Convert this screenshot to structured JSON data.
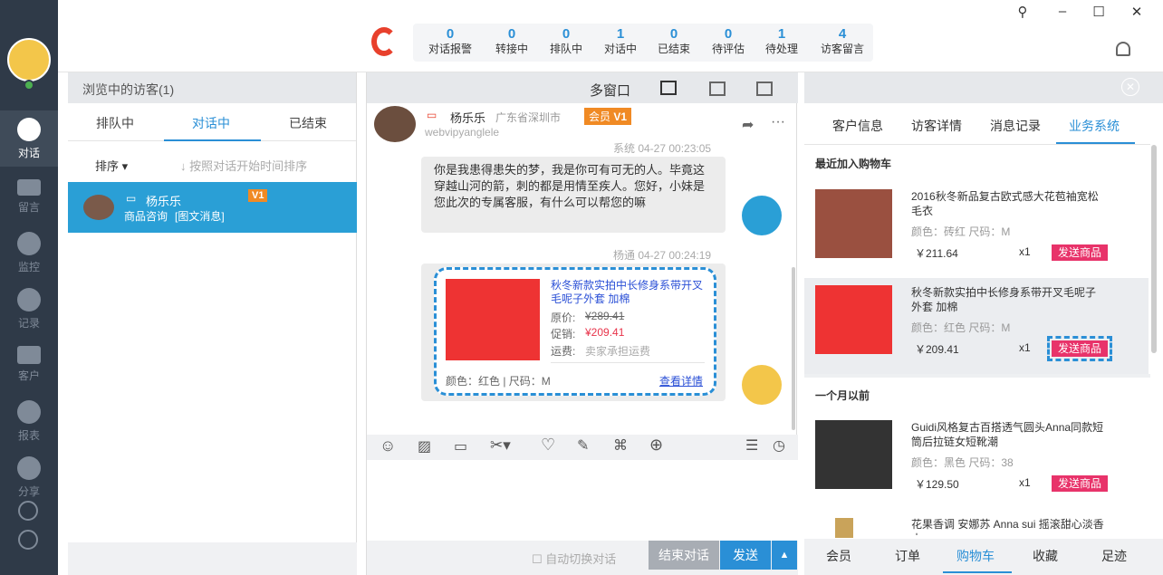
{
  "sidebar": {
    "items": [
      {
        "label": "对话"
      },
      {
        "label": "留言"
      },
      {
        "label": "监控"
      },
      {
        "label": "记录"
      },
      {
        "label": "客户"
      },
      {
        "label": "报表"
      },
      {
        "label": "分享"
      }
    ]
  },
  "stats": [
    {
      "count": "0",
      "label": "对话报警"
    },
    {
      "count": "0",
      "label": "转接中"
    },
    {
      "count": "0",
      "label": "排队中"
    },
    {
      "count": "1",
      "label": "对话中"
    },
    {
      "count": "0",
      "label": "已结束"
    },
    {
      "count": "0",
      "label": "待评估"
    },
    {
      "count": "1",
      "label": "待处理"
    },
    {
      "count": "4",
      "label": "访客留言"
    }
  ],
  "left": {
    "header": "浏览中的访客(1)",
    "tabs": [
      "排队中",
      "对话中",
      "已结束"
    ],
    "sort_label": "排序",
    "sort_hint": "按照对话开始时间排序",
    "visitor": {
      "name": "杨乐乐",
      "badge": "V1",
      "desc": "商品咨询",
      "desc_tag": "[图文消息]"
    }
  },
  "chat": {
    "multi_window": "多窗口",
    "name": "杨乐乐",
    "location": "广东省深圳市",
    "member": "会员",
    "member_level": "V1",
    "visitor_id": "webvipyanglele",
    "msg1_meta": "系统 04-27 00:23:05",
    "msg1_text": "你是我患得患失的梦，我是你可有可无的人。毕竟这穿越山河的箭，刺的都是用情至疾人。您好，小妹是您此次的专属客服，有什么可以帮您的嘛",
    "msg2_meta": "杨通 04-27 00:24:19",
    "card": {
      "title": "秋冬新款实拍中长修身系带开叉毛呢子外套 加棉",
      "orig_label": "原价:",
      "orig": "¥289.41",
      "promo_label": "促销:",
      "promo": "¥209.41",
      "ship_label": "运费:",
      "ship": "卖家承担运费",
      "attr": "颜色：红色 | 尺码：M",
      "detail": "查看详情"
    },
    "auto_switch": "自动切换对话",
    "end_btn": "结束对话",
    "send_btn": "发送"
  },
  "right": {
    "tabs": [
      "客户信息",
      "访客详情",
      "消息记录",
      "业务系统"
    ],
    "recent": "最近加入购物车",
    "older": "一个月以前",
    "products": [
      {
        "name": "2016秋冬新品复古欧式感大花苞袖宽松毛衣",
        "attr": "颜色：砖红 尺码：M",
        "price": "￥211.64",
        "qty": "x1",
        "send": "发送商品"
      },
      {
        "name": "秋冬新款实拍中长修身系带开叉毛呢子外套 加棉",
        "attr": "颜色：红色 尺码：M",
        "price": "￥209.41",
        "qty": "x1",
        "send": "发送商品"
      },
      {
        "name": "Guidi风格复古百搭透气圆头Anna同款短筒后拉链女短靴潮",
        "attr": "颜色：黑色 尺码：38",
        "price": "￥129.50",
        "qty": "x1",
        "send": "发送商品"
      },
      {
        "name": "花果香调 安娜苏 Anna sui 摇滚甜心淡香水"
      }
    ],
    "bottom_tabs": [
      "会员",
      "订单",
      "购物车",
      "收藏",
      "足迹"
    ]
  },
  "colors": {
    "sidebar": "#2f3a48",
    "accent": "#2a8fd6",
    "send": "#e8336a",
    "member": "#f08a24"
  }
}
